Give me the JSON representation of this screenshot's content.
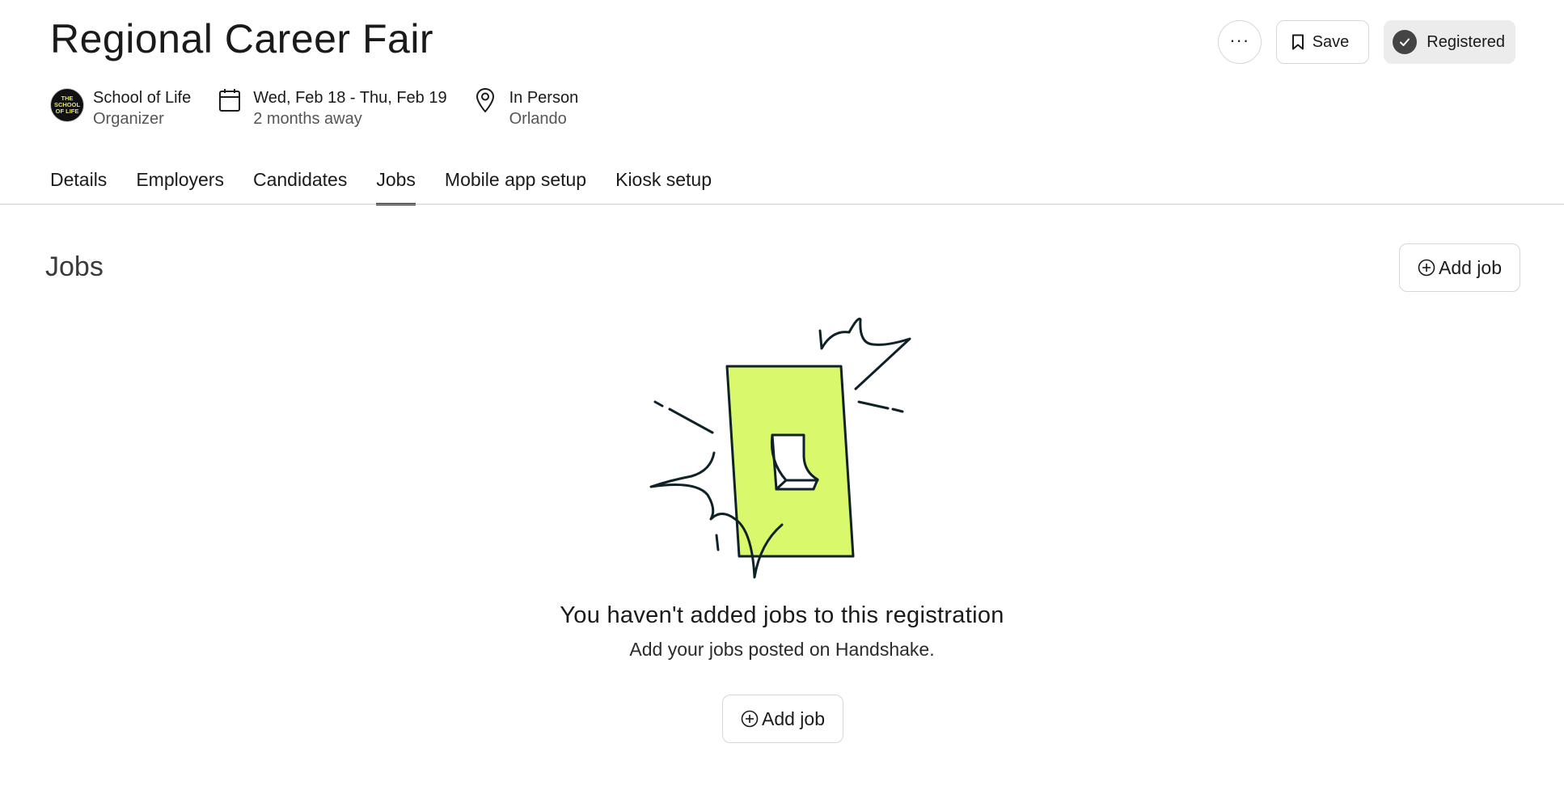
{
  "header": {
    "title": "Regional Career Fair",
    "more_label": "···",
    "save_label": "Save",
    "registered_label": "Registered"
  },
  "meta": {
    "organizer": {
      "name": "School of Life",
      "role": "Organizer",
      "logo_text": "THE SCHOOL OF LIFE"
    },
    "date": {
      "range": "Wed, Feb 18 - Thu, Feb 19",
      "relative": "2 months away"
    },
    "location": {
      "type": "In Person",
      "city": "Orlando"
    }
  },
  "tabs": [
    {
      "label": "Details",
      "active": false
    },
    {
      "label": "Employers",
      "active": false
    },
    {
      "label": "Candidates",
      "active": false
    },
    {
      "label": "Jobs",
      "active": true
    },
    {
      "label": "Mobile app setup",
      "active": false
    },
    {
      "label": "Kiosk setup",
      "active": false
    }
  ],
  "jobs": {
    "section_title": "Jobs",
    "add_job_label": "Add job",
    "empty_title": "You haven't added jobs to this registration",
    "empty_subtitle": "Add your jobs posted on Handshake.",
    "empty_add_label": "Add job"
  },
  "icons": {
    "more": "more-horizontal-icon",
    "save": "bookmark-icon",
    "registered": "check-circle-icon",
    "date": "calendar-icon",
    "location": "map-pin-icon",
    "add": "plus-circle-icon"
  },
  "colors": {
    "accent_lime": "#d9f86c",
    "line_dark": "#0f2228",
    "registered_bg": "#ececec",
    "check_bg": "#444444"
  }
}
